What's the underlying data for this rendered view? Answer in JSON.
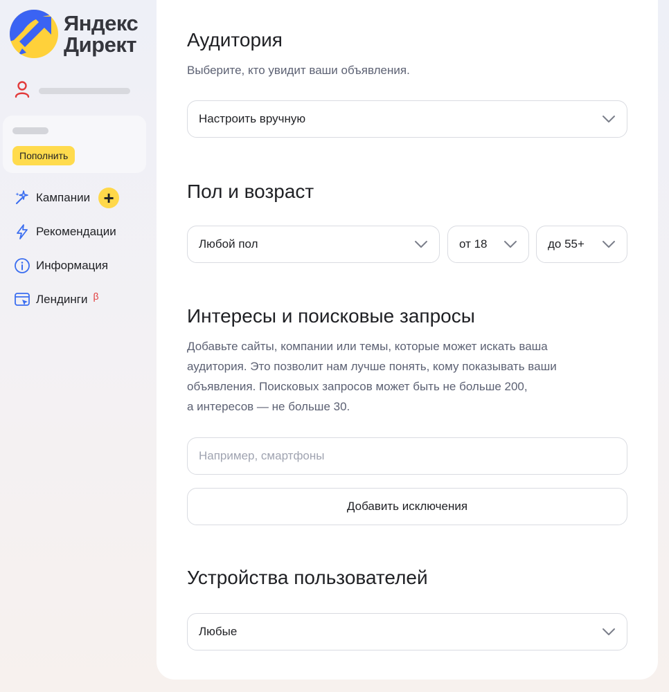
{
  "brand": {
    "line1": "Яндекс",
    "line2": "Директ"
  },
  "sidebar": {
    "topup_label": "Пополнить",
    "items": [
      {
        "label": "Кампании",
        "icon": "sparkle-wand-icon"
      },
      {
        "label": "Рекомендации",
        "icon": "lightning-icon"
      },
      {
        "label": "Информация",
        "icon": "info-icon"
      },
      {
        "label": "Лендинги",
        "icon": "landing-page-icon",
        "badge": "β"
      }
    ],
    "add_label": "+"
  },
  "audience": {
    "title": "Аудитория",
    "description": "Выберите, кто увидит ваши объявления.",
    "select_value": "Настроить вручную"
  },
  "gender_age": {
    "title": "Пол и возраст",
    "gender_value": "Любой пол",
    "age_from": "от 18",
    "age_to": "до 55+"
  },
  "interests": {
    "title": "Интересы и поисковые запросы",
    "description_lines": [
      "Добавьте сайты, компании или темы, которые может искать ваша",
      "аудитория. Это позволит нам лучше понять, кому показывать ваши",
      "объявления. Поисковых запросов может быть не больше 200,",
      "а интересов — не больше 30."
    ],
    "input_placeholder": "Например, смартфоны",
    "exclusions_button": "Добавить исключения"
  },
  "devices": {
    "title": "Устройства пользователей",
    "select_value": "Любые"
  },
  "colors": {
    "accent_yellow": "#ffdb4d",
    "brand_blue": "#3a63f3",
    "user_icon_red": "#e23b3b",
    "nav_icon_blue": "#3b6ef0"
  }
}
